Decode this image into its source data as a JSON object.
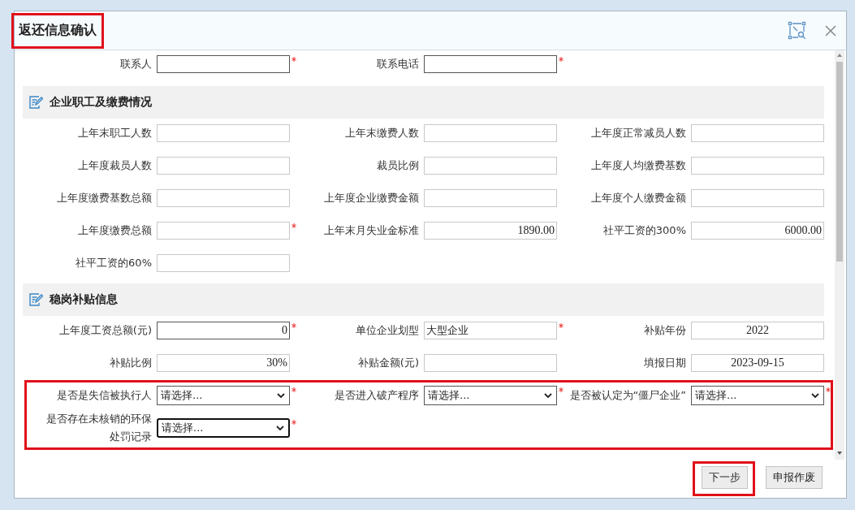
{
  "dialog": {
    "title": "返还信息确认",
    "title_highlighted": true
  },
  "contact_fields": [
    {
      "label": "联系人",
      "required": true,
      "readonly": false
    },
    {
      "label": "联系电话",
      "required": true,
      "readonly": false
    }
  ],
  "sections": [
    {
      "title": "企业职工及缴费情况",
      "groups": [
        {
          "highlighted": false,
          "fields": [
            {
              "label": "上年末职工人数",
              "kind": "number",
              "required": false,
              "readonly": true
            },
            {
              "label": "上年末缴费人数",
              "kind": "number",
              "required": false,
              "readonly": true
            },
            {
              "label": "上年度正常减员人数",
              "kind": "number",
              "required": false,
              "readonly": true
            },
            {
              "label": "上年度裁员人数",
              "kind": "number",
              "required": false,
              "readonly": true
            },
            {
              "label": "裁员比例",
              "kind": "number",
              "required": false,
              "readonly": true
            },
            {
              "label": "上年度人均缴费基数",
              "kind": "number",
              "required": false,
              "readonly": true
            },
            {
              "label": "上年度缴费基数总额",
              "kind": "number",
              "required": false,
              "readonly": true
            },
            {
              "label": "上年度企业缴费金额",
              "kind": "number",
              "required": false,
              "readonly": true
            },
            {
              "label": "上年度个人缴费金额",
              "kind": "number",
              "required": false,
              "readonly": true
            },
            {
              "label": "上年度缴费总额",
              "kind": "number",
              "required": true,
              "readonly": true
            },
            {
              "label": "上年末月失业金标准",
              "kind": "number",
              "value": "1890.00",
              "required": false,
              "readonly": true
            },
            {
              "label": "社平工资的300%",
              "kind": "number",
              "value": "6000.00",
              "required": false,
              "readonly": true
            },
            {
              "label": "社平工资的60%",
              "kind": "number",
              "required": false,
              "readonly": true
            }
          ]
        }
      ]
    },
    {
      "title": "稳岗补贴信息",
      "groups": [
        {
          "highlighted": false,
          "fields": [
            {
              "label": "上年度工资总额(元)",
              "kind": "number",
              "value": "0",
              "required": true,
              "readonly": false
            },
            {
              "label": "单位企业划型",
              "kind": "text",
              "value": "大型企业",
              "required": true,
              "readonly": true
            },
            {
              "label": "补贴年份",
              "kind": "date",
              "value": "2022",
              "required": false,
              "readonly": true
            },
            {
              "label": "补贴比例",
              "kind": "number",
              "value": "30%",
              "required": false,
              "readonly": true
            },
            {
              "label": "补贴金额(元)",
              "kind": "number",
              "required": false,
              "readonly": true
            },
            {
              "label": "填报日期",
              "kind": "date",
              "value": "2023-09-15",
              "required": false,
              "readonly": true
            }
          ]
        },
        {
          "highlighted": true,
          "fields": [
            {
              "label": "是否是失信被执行人",
              "kind": "select",
              "value": "请选择...",
              "required": true,
              "focused": false
            },
            {
              "label": "是否进入破产程序",
              "kind": "select",
              "value": "请选择...",
              "required": true,
              "focused": false
            },
            {
              "label": "是否被认定为“僵尸企业”",
              "kind": "select",
              "value": "请选择...",
              "required": true,
              "focused": false
            },
            {
              "label": "是否存在未核销的环保处罚记录",
              "kind": "select",
              "value": "请选择...",
              "required": true,
              "focused": true
            }
          ]
        }
      ]
    }
  ],
  "buttons": [
    {
      "label": "下一步",
      "highlighted": true
    },
    {
      "label": "申报作废",
      "highlighted": false
    }
  ]
}
